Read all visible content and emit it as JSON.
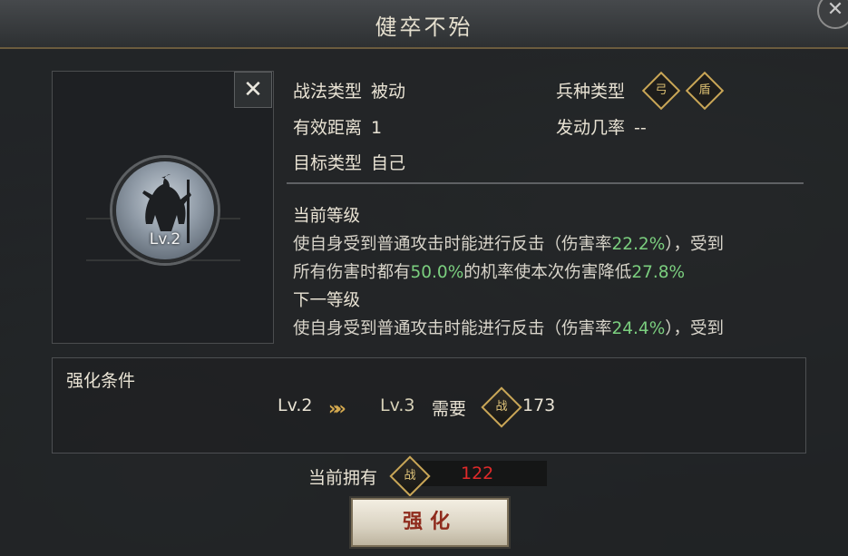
{
  "window": {
    "title": "健卒不殆",
    "close_glyph": "✕"
  },
  "portrait": {
    "level": "Lv.2",
    "close_glyph": "✕"
  },
  "info": {
    "tactic_type": {
      "label": "战法类型",
      "value": "被动"
    },
    "range": {
      "label": "有效距离",
      "value": "1"
    },
    "target": {
      "label": "目标类型",
      "value": "自己"
    },
    "troop_type": {
      "label": "兵种类型",
      "icons": [
        "bow-icon",
        "shield-icon"
      ]
    },
    "trigger_rate": {
      "label": "发动几率",
      "value": "--"
    }
  },
  "current_level": {
    "heading": "当前等级",
    "line1_pre": "使自身受到普通攻击时能进行反击（伤害率",
    "line1_pct": "22.2%",
    "line1_post": "），受到",
    "line2_pre": "所有伤害时都有",
    "line2_pct1": "50.0%",
    "line2_mid": "的机率使本次伤害降低",
    "line2_pct2": "27.8%"
  },
  "next_level": {
    "heading": "下一等级",
    "line1_pre": "使自身受到普通攻击时能进行反击（伤害率",
    "line1_pct": "24.4%",
    "line1_post": "），受到"
  },
  "upgrade": {
    "heading": "强化条件",
    "from_level": "Lv.2",
    "arrows": "»»",
    "to_level": "Lv.3",
    "need_label": "需要",
    "cost": "173",
    "owned_label": "当前拥有",
    "owned_value": "122",
    "button_label": "强化"
  },
  "colors": {
    "highlight": "#7bcf7f",
    "insufficient": "#e02a2a",
    "gold": "#c9a657"
  }
}
